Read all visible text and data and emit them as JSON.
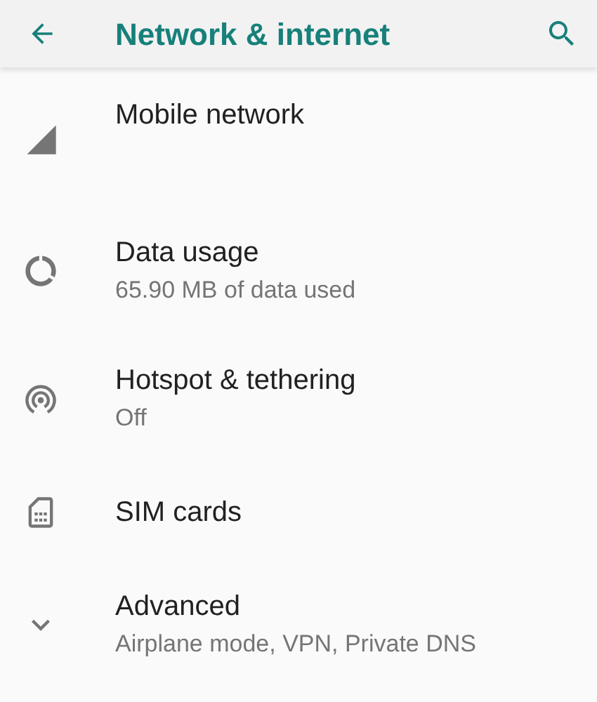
{
  "app_bar": {
    "title": "Network & internet"
  },
  "items": [
    {
      "kind": "signal",
      "title": "Mobile network"
    },
    {
      "kind": "data",
      "title": "Data usage",
      "summary": "65.90 MB of data used"
    },
    {
      "kind": "hotspot",
      "title": "Hotspot & tethering",
      "summary": "Off"
    },
    {
      "kind": "sim",
      "title": "SIM cards"
    },
    {
      "kind": "expand",
      "title": "Advanced",
      "summary": "Airplane mode, VPN, Private DNS"
    }
  ]
}
